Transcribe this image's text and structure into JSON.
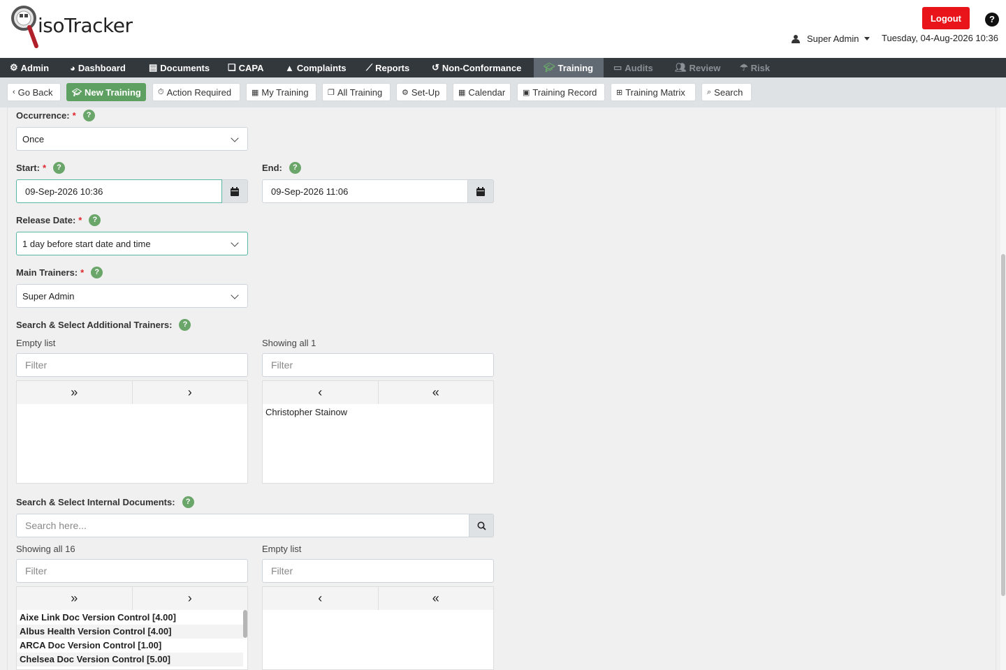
{
  "header": {
    "logo_text": "isoTracker",
    "logout_label": "Logout",
    "help_label": "?",
    "user_name": "Super Admin",
    "datetime": "Tuesday, 04-Aug-2026 10:36"
  },
  "mainnav": [
    {
      "label": "Admin",
      "icon": "gear-icon"
    },
    {
      "label": "Dashboard",
      "icon": "dashboard-icon"
    },
    {
      "label": "Documents",
      "icon": "document-icon"
    },
    {
      "label": "CAPA",
      "icon": "chat-icon"
    },
    {
      "label": "Complaints",
      "icon": "warning-icon"
    },
    {
      "label": "Reports",
      "icon": "chart-icon"
    },
    {
      "label": "Non-Conformance",
      "icon": "history-icon"
    },
    {
      "label": "Training",
      "icon": "graduation-cap-icon"
    },
    {
      "label": "Audits",
      "icon": "audit-icon"
    },
    {
      "label": "Review",
      "icon": "users-icon"
    },
    {
      "label": "Risk",
      "icon": "umbrella-icon"
    }
  ],
  "subnav": [
    {
      "label": "Go Back",
      "icon": "chevron-left-icon"
    },
    {
      "label": "New Training",
      "icon": "graduation-cap-icon"
    },
    {
      "label": "Action Required",
      "icon": "stopwatch-icon"
    },
    {
      "label": "My Training",
      "icon": "briefcase-icon"
    },
    {
      "label": "All Training",
      "icon": "copy-icon"
    },
    {
      "label": "Set-Up",
      "icon": "cogs-icon"
    },
    {
      "label": "Calendar",
      "icon": "calendar-icon"
    },
    {
      "label": "Training Record",
      "icon": "record-icon"
    },
    {
      "label": "Training Matrix",
      "icon": "table-icon"
    },
    {
      "label": "Search",
      "icon": "search-icon"
    }
  ],
  "form": {
    "occurrence": {
      "label": "Occurrence:",
      "required": "*",
      "value": "Once"
    },
    "start": {
      "label": "Start:",
      "required": "*",
      "value": "09-Sep-2026 10:36"
    },
    "end": {
      "label": "End:",
      "value": "09-Sep-2026 11:06"
    },
    "release_date": {
      "label": "Release Date:",
      "required": "*",
      "value": "1 day before start date and time"
    },
    "main_trainers": {
      "label": "Main Trainers:",
      "required": "*",
      "value": "Super Admin"
    },
    "additional_trainers": {
      "label": "Search & Select Additional Trainers:",
      "left_status": "Empty list",
      "right_status": "Showing all 1",
      "filter_placeholder": "Filter",
      "left_items": [],
      "right_items": [
        "Christopher Stainow"
      ]
    },
    "internal_documents": {
      "label": "Search & Select Internal Documents:",
      "search_placeholder": "Search here...",
      "left_status": "Showing all 16",
      "right_status": "Empty list",
      "filter_placeholder": "Filter",
      "left_items": [
        "Aixe Link Doc Version Control [4.00]",
        "Albus Health Version Control [4.00]",
        "ARCA Doc Version Control [1.00]",
        "Chelsea Doc Version Control [5.00]"
      ],
      "right_items": []
    },
    "help_label": "?"
  },
  "colors": {
    "nav_bg": "#33383d",
    "nav_active": "#616a72",
    "accent_green": "#5ea062",
    "logout_red": "#e8141a",
    "focus_border": "#56b7a5"
  }
}
